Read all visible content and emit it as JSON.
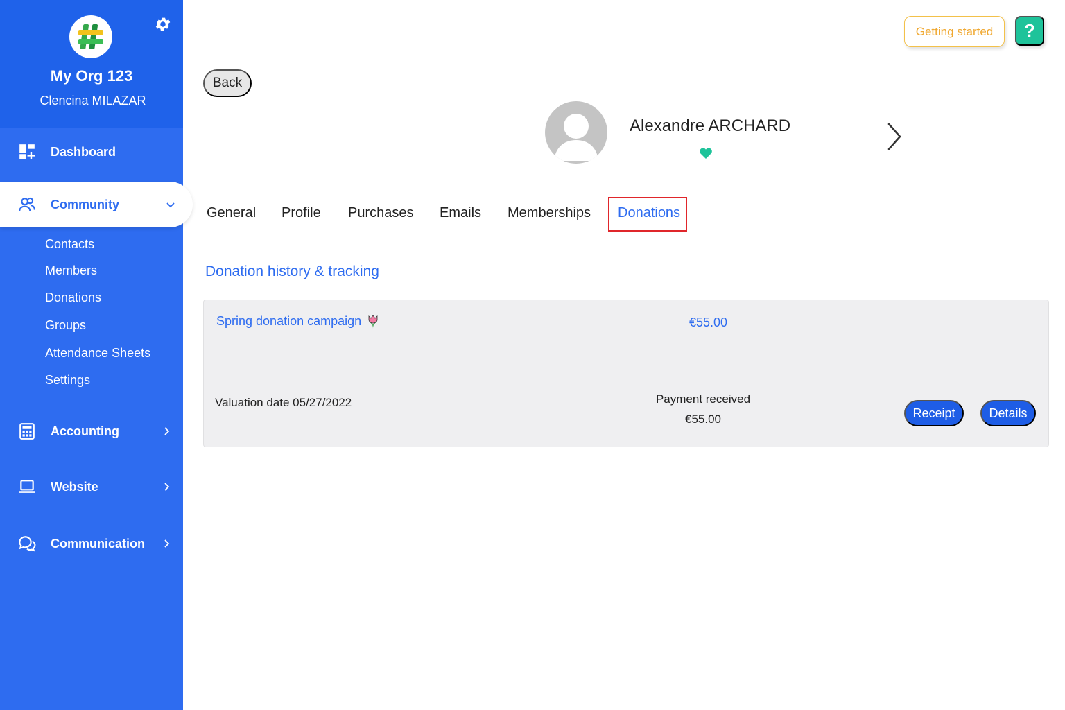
{
  "org": {
    "name": "My Org 123",
    "user": "Clencina MILAZAR"
  },
  "nav": {
    "dashboard": "Dashboard",
    "community": "Community",
    "community_items": [
      "Contacts",
      "Members",
      "Donations",
      "Groups",
      "Attendance Sheets",
      "Settings"
    ],
    "accounting": "Accounting",
    "website": "Website",
    "communication": "Communication"
  },
  "header": {
    "getting_started": "Getting started",
    "help": "?"
  },
  "back_label": "Back",
  "contact": {
    "name": "Alexandre ARCHARD"
  },
  "tabs": [
    "General",
    "Profile",
    "Purchases",
    "Emails",
    "Memberships",
    "Donations"
  ],
  "active_tab": "Donations",
  "section_title": "Donation history & tracking",
  "donation": {
    "campaign": "Spring donation campaign",
    "amount": "€55.00",
    "valuation": "Valuation date 05/27/2022",
    "payment_status": "Payment received",
    "payment_amount": "€55.00",
    "receipt_label": "Receipt",
    "details_label": "Details"
  },
  "colors": {
    "sidebar": "#2e6cf0",
    "accent": "#2e6cf0",
    "help": "#1ec39a",
    "getting_started": "#f0a830",
    "active_tab_border": "#e0262b"
  },
  "icons": {
    "logo": "org-logo",
    "settings": "gear-icon",
    "dashboard": "dashboard-icon",
    "community": "community-icon",
    "accounting": "calculator-icon",
    "website": "laptop-icon",
    "communication": "chat-icon",
    "favorite": "heart-icon",
    "next": "chevron-right-icon",
    "campaign": "tulip-icon"
  }
}
